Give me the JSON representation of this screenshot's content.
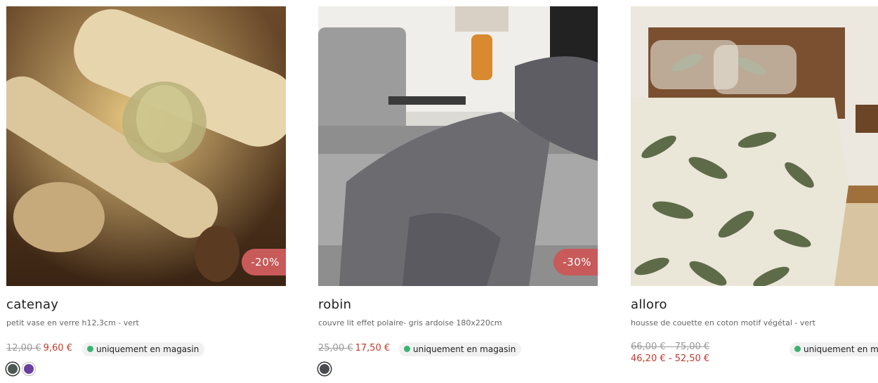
{
  "products": [
    {
      "name": "catenay",
      "description": "petit vase en verre h12,3cm - vert",
      "old_price": "12,00 €",
      "new_price": "9,60 €",
      "discount": "-20%",
      "availability": "uniquement en magasin",
      "swatches": [
        "#4b5a52",
        "#6b3fa0"
      ]
    },
    {
      "name": "robin",
      "description": "couvre lit effet polaire- gris ardoise 180x220cm",
      "old_price": "25,00 €",
      "new_price": "17,50 €",
      "discount": "-30%",
      "availability": "uniquement en magasin",
      "swatches": [
        "#4a4c50"
      ]
    },
    {
      "name": "alloro",
      "description": "housse de couette en coton motif végétal - vert",
      "old_price": "66,00 € - 75,00 €",
      "new_price": "46,20 € - 52,50 €",
      "availability": "uniquement en magasin"
    }
  ],
  "colors": {
    "badge": "#c85a5a",
    "sale_price": "#c0392b",
    "availability_dot": "#3cb371"
  }
}
